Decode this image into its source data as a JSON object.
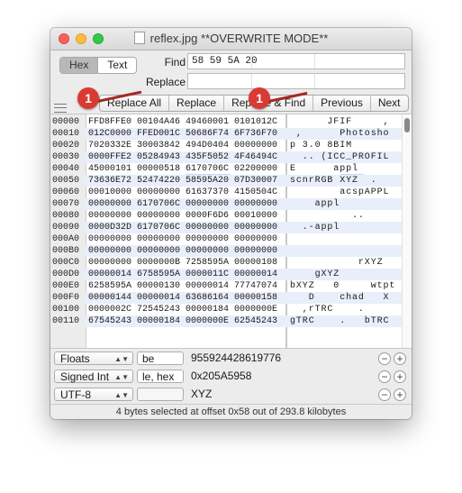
{
  "window": {
    "title": "reflex.jpg **OVERWRITE MODE**"
  },
  "mode_toggle": {
    "hex_label": "Hex",
    "text_label": "Text"
  },
  "find": {
    "label": "Find",
    "value": "58 59 5A 20"
  },
  "replace": {
    "label": "Replace",
    "value": ""
  },
  "buttons": {
    "replace_all": "Replace All",
    "replace": "Replace",
    "replace_find": "Replace & Find",
    "previous": "Previous",
    "next": "Next"
  },
  "hex_view": {
    "selection_hex": "58595A20",
    "selection_ascii": "XYZ",
    "rows": [
      {
        "offset": "00000",
        "hex": "FFD8FFE0 00104A46 49460001 0101012C",
        "ascii": "      JFIF     ,"
      },
      {
        "offset": "00010",
        "hex": "012C0000 FFED001C 50686F74 6F736F70",
        "ascii": " ,      Photosho"
      },
      {
        "offset": "00020",
        "hex": "7020332E 30003842 494D0404 00000000",
        "ascii": "p 3.0 8BIM"
      },
      {
        "offset": "00030",
        "hex": "0000FFE2 05284943 435F5052 4F46494C",
        "ascii": "  .. (ICC_PROFIL"
      },
      {
        "offset": "00040",
        "hex": "45000101 00000518 6170706C 02200000",
        "ascii": "E      appl"
      },
      {
        "offset": "00050",
        "hex": "73636E72 52474220 58595A20 07D30007",
        "ascii": "scnrRGB XYZ  ."
      },
      {
        "offset": "00060",
        "hex": "00010000 00000000 61637370 4150504C",
        "ascii": "        acspAPPL"
      },
      {
        "offset": "00070",
        "hex": "00000000 6170706C 00000000 00000000",
        "ascii": "    appl"
      },
      {
        "offset": "00080",
        "hex": "00000000 00000000 0000F6D6 00010000",
        "ascii": "          .."
      },
      {
        "offset": "00090",
        "hex": "0000D32D 6170706C 00000000 00000000",
        "ascii": "  .-appl"
      },
      {
        "offset": "000A0",
        "hex": "00000000 00000000 00000000 00000000",
        "ascii": ""
      },
      {
        "offset": "000B0",
        "hex": "00000000 00000000 00000000 00000000",
        "ascii": ""
      },
      {
        "offset": "000C0",
        "hex": "00000000 0000000B 7258595A 00000108",
        "ascii": "           rXYZ"
      },
      {
        "offset": "000D0",
        "hex": "00000014 6758595A 0000011C 00000014",
        "ascii": "    gXYZ"
      },
      {
        "offset": "000E0",
        "hex": "6258595A 00000130 00000014 77747074",
        "ascii": "bXYZ   0     wtpt"
      },
      {
        "offset": "000F0",
        "hex": "00000144 00000014 63686164 00000158",
        "ascii": "   D    chad   X"
      },
      {
        "offset": "00100",
        "hex": "0000002C 72545243 00000184 0000000E",
        "ascii": "  ,rTRC    ."
      },
      {
        "offset": "00110",
        "hex": "67545243 00000184 0000000E 62545243",
        "ascii": "gTRC    .   bTRC"
      }
    ]
  },
  "badges": {
    "first": "1",
    "second": "1"
  },
  "inspector": [
    {
      "type": "Floats",
      "option": "be",
      "value": "955924428619776"
    },
    {
      "type": "Signed Int",
      "option": "le, hex",
      "value": "0x205A5958"
    },
    {
      "type": "UTF-8",
      "option": "",
      "value": "XYZ"
    }
  ],
  "status": {
    "text": "4 bytes selected at offset 0x58 out of 293.8 kilobytes"
  }
}
